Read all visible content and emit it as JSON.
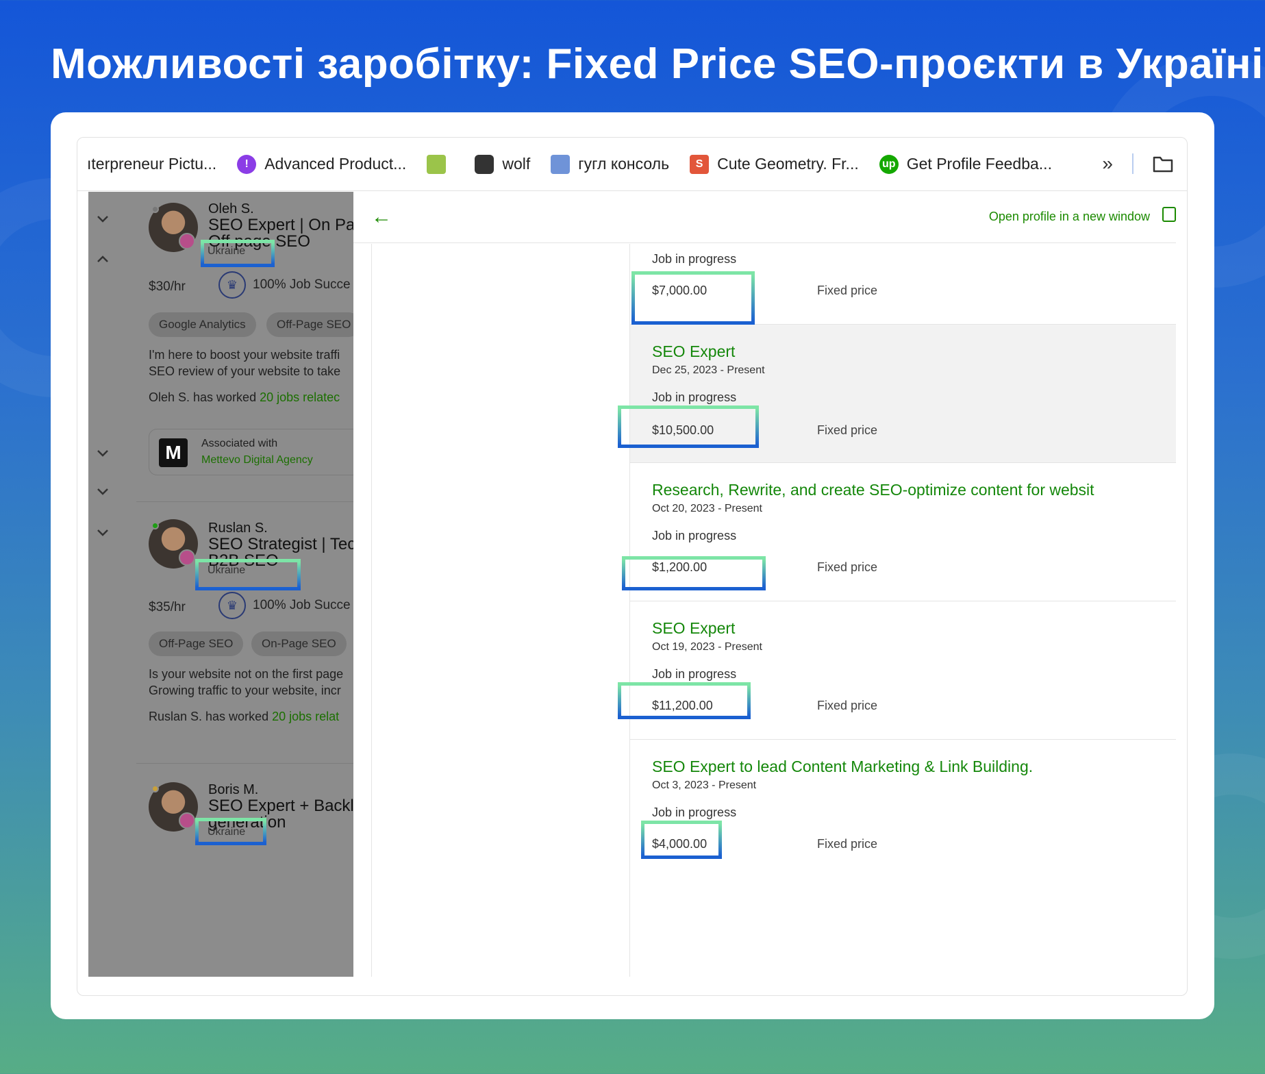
{
  "headline": "Можливості заробітку: Fixed Price SEO-проєкти в Україні",
  "bookmarks": [
    {
      "label": "ıterpreneur Pictu...",
      "icon": "none"
    },
    {
      "label": "Advanced Product...",
      "icon": "purple-circle-icon"
    },
    {
      "label": "",
      "icon": "gift-icon"
    },
    {
      "label": "wolf",
      "icon": "wolf-icon"
    },
    {
      "label": "гугл консоль",
      "icon": "search-console-icon"
    },
    {
      "label": "Cute Geometry. Fr...",
      "icon": "s-logo-icon"
    },
    {
      "label": "Get Profile Feedba...",
      "icon": "upwork-icon"
    }
  ],
  "bookmark_icons": {
    "overflow": "»"
  },
  "freelancers": [
    {
      "name": "Oleh S.",
      "title_line1": "SEO Expert | On Pa",
      "title_line2": "Off page SEO",
      "country": "Ukraine",
      "rate": "$30/hr",
      "job_success": "100% Job Succe",
      "skills": [
        "Google Analytics",
        "Off-Page SEO"
      ],
      "desc_line1": "I'm here to boost your website traffi",
      "desc_line2": "SEO review of your website to take",
      "worked_prefix": "Oleh S. has worked ",
      "worked_link": "20 jobs relatec",
      "assoc_label": "Associated with",
      "assoc_name": "Mettevo Digital Agency",
      "assoc_logo": "M"
    },
    {
      "name": "Ruslan S.",
      "title_line1": "SEO Strategist | Tec",
      "title_line2": "B2B SEO",
      "country": "Ukraine",
      "rate": "$35/hr",
      "job_success": "100% Job Succe",
      "skills": [
        "Off-Page SEO",
        "On-Page SEO"
      ],
      "desc_line1": "Is your website not on the first page",
      "desc_line2": "Growing traffic to your website, incr",
      "worked_prefix": "Ruslan S. has worked ",
      "worked_link": "20 jobs relat"
    },
    {
      "name": "Boris M.",
      "title_line1": "SEO Expert + Backl",
      "title_line2": "generation",
      "country": "Ukraine"
    }
  ],
  "right": {
    "open_profile": "Open profile in a new window",
    "jobs": [
      {
        "title": "",
        "date": "",
        "status": "Job in progress",
        "amount": "$7,000.00",
        "type": "Fixed price"
      },
      {
        "title": "SEO Expert",
        "date": "Dec 25, 2023 - Present",
        "status": "Job in progress",
        "amount": "$10,500.00",
        "type": "Fixed price"
      },
      {
        "title": "Research, Rewrite, and create SEO-optimize content for websit",
        "date": "Oct 20, 2023 - Present",
        "status": "Job in progress",
        "amount": "$1,200.00",
        "type": "Fixed price"
      },
      {
        "title": "SEO Expert",
        "date": "Oct 19, 2023 - Present",
        "status": "Job in progress",
        "amount": "$11,200.00",
        "type": "Fixed price"
      },
      {
        "title": "SEO Expert to lead Content Marketing & Link Building.",
        "date": "Oct 3, 2023 - Present",
        "status": "Job in progress",
        "amount": "$4,000.00",
        "type": "Fixed price"
      }
    ]
  },
  "colors": {
    "accent_green": "#14870a",
    "highlight_top": "#7ee6a6",
    "highlight_bottom": "#1a5fd1"
  }
}
